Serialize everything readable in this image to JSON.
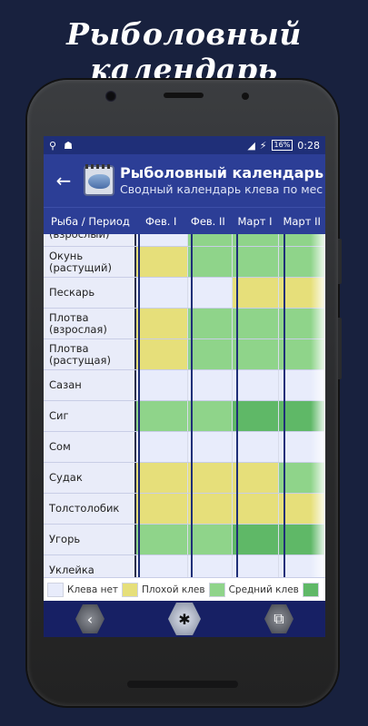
{
  "promo": {
    "title": "Рыболовный календарь"
  },
  "status": {
    "battery": "16%",
    "time": "0:28"
  },
  "appbar": {
    "title": "Рыболовный календарь",
    "subtitle": "Сводный календарь клева по мес"
  },
  "table": {
    "header_fish": "Рыба / Период",
    "periods": [
      "Фев. I",
      "Фев. II",
      "Март I",
      "Март II"
    ],
    "rows": [
      {
        "name": "(взрослый)",
        "ratings": [
          "none",
          "medium",
          "medium",
          "medium"
        ]
      },
      {
        "name": "Окунь (растущий)",
        "ratings": [
          "poor",
          "medium",
          "medium",
          "medium"
        ]
      },
      {
        "name": "Пескарь",
        "ratings": [
          "none",
          "none",
          "poor",
          "poor"
        ]
      },
      {
        "name": "Плотва (взрослая)",
        "ratings": [
          "poor",
          "medium",
          "medium",
          "medium"
        ]
      },
      {
        "name": "Плотва (растущая)",
        "ratings": [
          "poor",
          "medium",
          "medium",
          "medium"
        ]
      },
      {
        "name": "Сазан",
        "ratings": [
          "none",
          "none",
          "none",
          "none"
        ]
      },
      {
        "name": "Сиг",
        "ratings": [
          "medium",
          "medium",
          "good",
          "good"
        ]
      },
      {
        "name": "Сом",
        "ratings": [
          "none",
          "none",
          "none",
          "none"
        ]
      },
      {
        "name": "Судак",
        "ratings": [
          "poor",
          "poor",
          "poor",
          "medium"
        ]
      },
      {
        "name": "Толстолобик",
        "ratings": [
          "poor",
          "poor",
          "poor",
          "poor"
        ]
      },
      {
        "name": "Угорь",
        "ratings": [
          "medium",
          "medium",
          "good",
          "good"
        ]
      },
      {
        "name": "Уклейка",
        "ratings": [
          "none",
          "none",
          "none",
          "none"
        ]
      }
    ]
  },
  "legend": [
    {
      "label": "Клева нет",
      "color": "#e8ecfb"
    },
    {
      "label": "Плохой клев",
      "color": "#e6df7a"
    },
    {
      "label": "Средний клев",
      "color": "#8fd48a"
    },
    {
      "label": "",
      "color": "#5fb867"
    }
  ],
  "colors": {
    "none": "#e8ecfb",
    "poor": "#e6df7a",
    "medium": "#8fd48a",
    "good": "#5fb867",
    "accent": "#2c3e96"
  },
  "icons": {
    "back": "arrow-left-icon",
    "nav_back": "chevron-left-icon",
    "nav_home": "spider-icon",
    "nav_recent": "recent-apps-icon"
  }
}
